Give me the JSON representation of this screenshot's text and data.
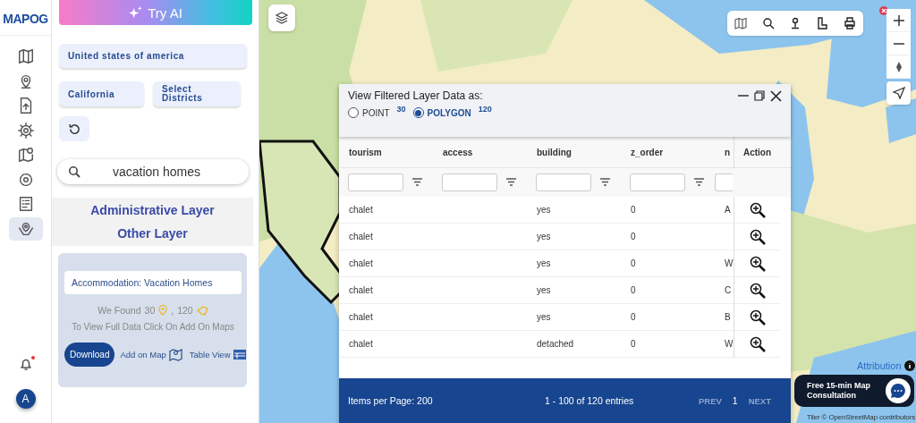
{
  "logo": "MAPOG",
  "rail": {
    "items": [
      {
        "kind": "map",
        "selected": false
      },
      {
        "kind": "pin",
        "selected": false
      },
      {
        "kind": "upload",
        "selected": false
      },
      {
        "kind": "gear",
        "selected": false
      },
      {
        "kind": "mappin",
        "selected": false
      },
      {
        "kind": "settings",
        "selected": false
      },
      {
        "kind": "report",
        "selected": false
      },
      {
        "kind": "vector",
        "selected": true
      }
    ],
    "notification": {
      "unread": true
    },
    "avatar": "A"
  },
  "sidebar": {
    "try_ai": "Try AI",
    "country": "United states of america",
    "state": "California",
    "district": "Select Districts",
    "search": {
      "value": "vacation homes"
    },
    "layers": [
      "Administrative Layer",
      "Other Layer"
    ],
    "result": {
      "title": "Accommodation: Vacation Homes",
      "found_label": "We Found",
      "point_count": "30",
      "polygon_count": "120",
      "separator": ",",
      "hint": "To View Full Data Click On Add On Maps",
      "download": "Download",
      "add_on_map": "Add on Map",
      "table_view": "Table View"
    }
  },
  "map": {
    "attribution": "Attribution",
    "credits": "Tiler © OpenStreetMap contributors",
    "consultation": "Free 15-min Map Consultation",
    "toolbar_alert": true
  },
  "dialog": {
    "title": "View Filtered Layer Data as:",
    "options": [
      {
        "label": "POINT",
        "count": "30",
        "selected": false
      },
      {
        "label": "POLYGON",
        "count": "120",
        "selected": true
      }
    ],
    "columns": [
      "tourism",
      "access",
      "building",
      "z_order",
      "n",
      "Action"
    ],
    "rows": [
      [
        "chalet",
        "",
        "yes",
        "0",
        "A"
      ],
      [
        "chalet",
        "",
        "yes",
        "0",
        ""
      ],
      [
        "chalet",
        "",
        "yes",
        "0",
        "W"
      ],
      [
        "chalet",
        "",
        "yes",
        "0",
        "C"
      ],
      [
        "chalet",
        "",
        "yes",
        "0",
        "B"
      ],
      [
        "chalet",
        "",
        "detached",
        "0",
        "W"
      ]
    ],
    "footer": {
      "items_per_page": "Items per Page: 200",
      "range": "1 - 100 of 120 entries",
      "prev": "PREV",
      "page": "1",
      "next": "NEXT"
    }
  }
}
